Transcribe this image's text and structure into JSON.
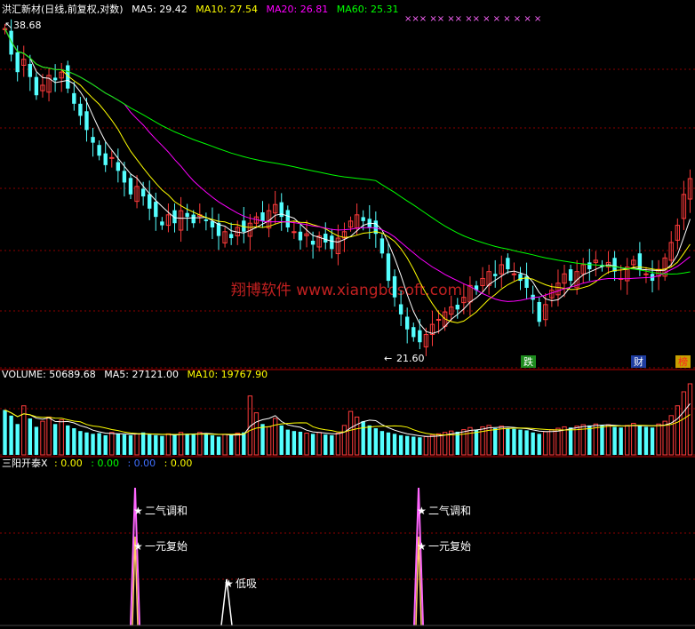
{
  "colors": {
    "background": "#000000",
    "grid": "#8b0000",
    "up": "#ff3b3b",
    "down": "#54ffff",
    "ma5": "#ffffff",
    "ma10": "#ffff00",
    "ma20": "#ff00ff",
    "ma60": "#00ff00",
    "watermark": "#c02020",
    "ind_pink": "#ff66ff",
    "ind_yellow": "#ffcc66",
    "ind_white": "#ffffff"
  },
  "main": {
    "title": "洪汇新材(日线,前复权,对数)",
    "ma5_label": "MA5: 29.42",
    "ma10_label": "MA10: 27.54",
    "ma20_label": "MA20: 26.81",
    "ma60_label": "MA60: 25.31",
    "high_label": "38.68",
    "low_label": "21.60",
    "markers": [
      "跌",
      "财",
      "榜"
    ],
    "top_markers": "××× ×× ×× ×× × × × × × ×",
    "watermark": "翔博软件 www.xiangbosoft.com"
  },
  "volume": {
    "title": "VOLUME: 50689.68",
    "ma5_label": "MA5: 27121.00",
    "ma10_label": "MA10: 19767.90"
  },
  "indicator": {
    "title": "三阳开泰X",
    "v1": ": 0.00",
    "v2": ": 0.00",
    "v3": ": 0.00",
    "v4": ": 0.00",
    "signal_1": "二气调和",
    "signal_2": "一元复始",
    "signal_3": "低吸"
  },
  "chart_data": {
    "type": "candlestick",
    "price_range": [
      21.6,
      38.68
    ],
    "close": [
      38.2,
      36.5,
      35.4,
      36.2,
      35.1,
      34.0,
      34.6,
      35.2,
      34.9,
      35.4,
      34.4,
      33.5,
      32.8,
      32.0,
      31.3,
      30.6,
      30.1,
      30.5,
      29.8,
      29.2,
      28.6,
      29.0,
      28.5,
      27.9,
      27.5,
      27.1,
      27.6,
      27.2,
      27.8,
      27.5,
      27.2,
      27.6,
      27.3,
      27.0,
      26.6,
      26.8,
      26.5,
      27.0,
      26.8,
      27.2,
      27.5,
      27.3,
      27.8,
      28.1,
      27.5,
      27.0,
      26.8,
      26.4,
      26.7,
      26.2,
      26.6,
      26.3,
      26.0,
      26.5,
      26.8,
      27.3,
      27.6,
      27.3,
      27.0,
      26.7,
      25.8,
      24.6,
      23.9,
      23.2,
      22.6,
      22.3,
      22.1,
      22.4,
      22.8,
      23.0,
      23.3,
      23.5,
      23.4,
      23.9,
      24.4,
      24.2,
      24.7,
      25.0,
      24.8,
      25.3,
      25.1,
      24.9,
      24.6,
      24.3,
      23.8,
      22.9,
      23.6,
      24.2,
      24.5,
      24.9,
      24.6,
      25.0,
      25.3,
      25.1,
      25.5,
      25.2,
      25.4,
      25.0,
      24.7,
      25.2,
      25.5,
      25.1,
      24.9,
      24.6,
      25.1,
      25.6,
      26.3,
      27.1,
      28.6,
      29.4
    ],
    "volume": [
      32000,
      28000,
      22000,
      35000,
      26000,
      20000,
      24000,
      27000,
      22000,
      25000,
      21000,
      19000,
      17000,
      16000,
      15000,
      15500,
      14000,
      16000,
      15000,
      14500,
      14000,
      15000,
      16000,
      14500,
      14000,
      13500,
      15000,
      14000,
      16000,
      15000,
      14500,
      16000,
      15500,
      14000,
      13000,
      14500,
      14000,
      15500,
      16000,
      42000,
      30000,
      22000,
      20000,
      26000,
      21000,
      18000,
      17000,
      16500,
      15500,
      15000,
      16000,
      14500,
      14000,
      15500,
      21000,
      31000,
      27000,
      24000,
      21000,
      19000,
      17000,
      16000,
      15000,
      14000,
      13500,
      13000,
      12500,
      13000,
      14000,
      15000,
      16000,
      17000,
      16500,
      18000,
      19500,
      18000,
      20000,
      21000,
      19000,
      20500,
      19000,
      18500,
      18000,
      17500,
      16000,
      15000,
      16500,
      18000,
      19000,
      20000,
      19500,
      20500,
      21500,
      21000,
      22000,
      21000,
      21500,
      20000,
      19500,
      21000,
      22500,
      21000,
      20000,
      19500,
      22000,
      24000,
      28000,
      35000,
      45000,
      50689.68
    ]
  }
}
